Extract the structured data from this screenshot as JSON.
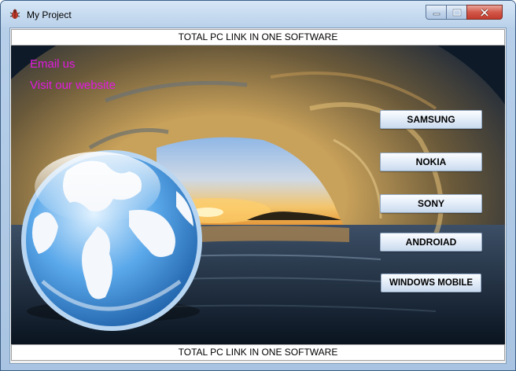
{
  "window": {
    "title": "My Project"
  },
  "banner": {
    "top_text": "TOTAL PC LINK IN ONE SOFTWARE",
    "bottom_text": "TOTAL PC LINK IN ONE SOFTWARE"
  },
  "links": {
    "email": "Email us",
    "website": "Visit our website",
    "color": "#e21ae0"
  },
  "buttons": [
    {
      "label": "SAMSUNG"
    },
    {
      "label": "NOKIA"
    },
    {
      "label": "SONY"
    },
    {
      "label": "ANDROIAD"
    },
    {
      "label": "WINDOWS MOBILE"
    }
  ],
  "icons": {
    "app": "app-bug-icon",
    "minimize": "minimize-icon",
    "maximize": "maximize-icon",
    "close": "close-icon",
    "globe": "globe-icon"
  }
}
